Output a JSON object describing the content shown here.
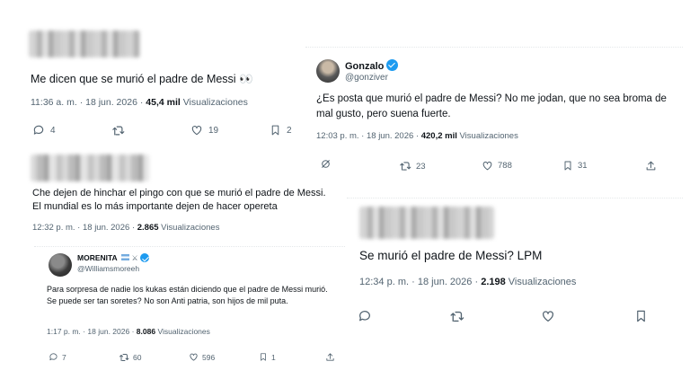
{
  "tweets": [
    {
      "text": "Me dicen que se murió el padre de Messi 👀",
      "time": "11:36 a. m.",
      "dot": "·",
      "date": "18 jun. 2026",
      "views_count": "45,4 mil",
      "views_label": "Visualizaciones",
      "replies": "4",
      "retweets": "",
      "likes": "19",
      "bookmarks": "2"
    },
    {
      "text": "Che dejen de hinchar el pingo con que se murió el padre de Messi. El mundial es lo más importante dejen de hacer opereta",
      "time": "12:32 p. m.",
      "dot": "·",
      "date": "18 jun. 2026",
      "views_count": "2.865",
      "views_label": "Visualizaciones"
    },
    {
      "display_name": "MORENITA",
      "handle": "@Williamsmoreeh",
      "text": "Para sorpresa de nadie los kukas están diciendo que el padre de Messi murió. Se puede ser tan soretes? No son Anti patria, son hijos de mil puta.",
      "time": "1:17 p. m.",
      "dot": "·",
      "date": "18 jun. 2026",
      "views_count": "8.086",
      "views_label": "Visualizaciones",
      "replies": "7",
      "retweets": "60",
      "likes": "596",
      "bookmarks": "1"
    },
    {
      "display_name": "Gonzalo",
      "handle": "@gonziver",
      "text": "¿Es posta que murió el padre de Messi? No me jodan, que no sea broma de mal gusto, pero suena fuerte.",
      "time": "12:03 p. m.",
      "dot": "·",
      "date": "18 jun. 2026",
      "views_count": "420,2 mil",
      "views_label": "Visualizaciones",
      "retweets": "23",
      "likes": "788",
      "bookmarks": "31"
    },
    {
      "text": "Se murió el padre de Messi? LPM",
      "time": "12:34 p. m.",
      "dot": "·",
      "date": "18 jun. 2026",
      "views_count": "2.198",
      "views_label": "Visualizaciones"
    }
  ]
}
